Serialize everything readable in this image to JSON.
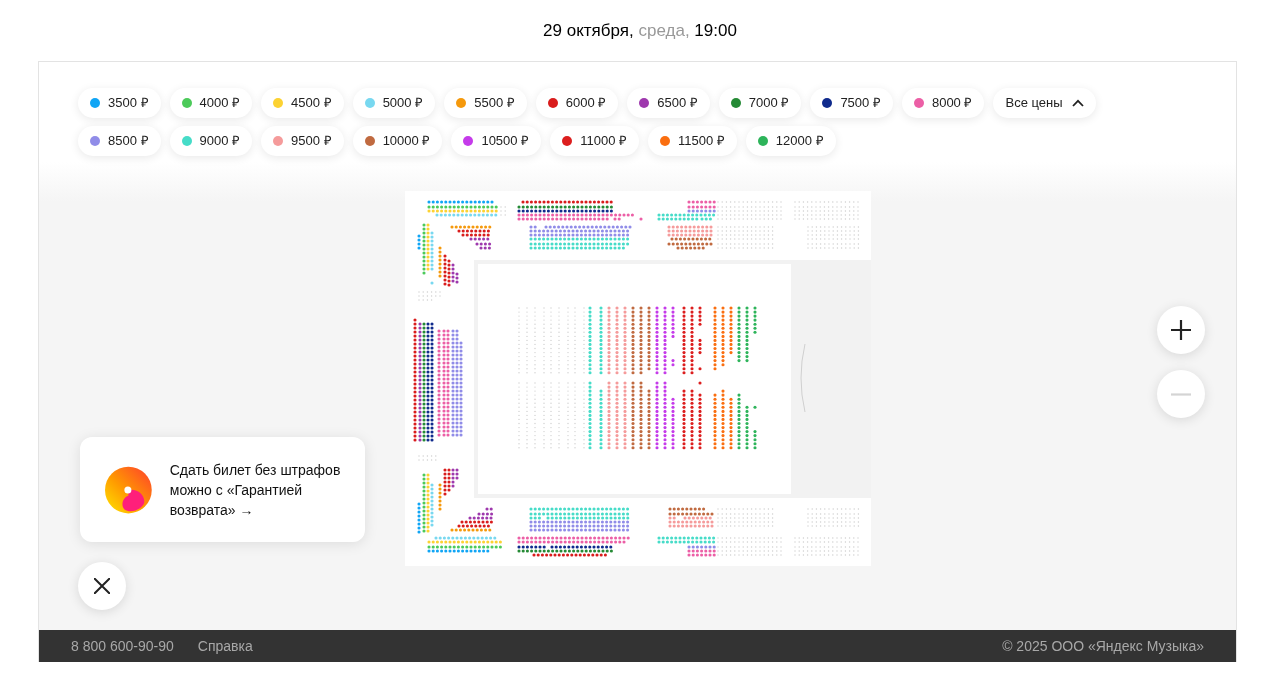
{
  "event_datetime": {
    "date": "29 октября,",
    "weekday": "среда,",
    "time": "19:00"
  },
  "price_filter_rows": [
    {
      "chips": [
        {
          "label": "3500 ₽",
          "color": "#10a5f5"
        },
        {
          "label": "4000 ₽",
          "color": "#4cca5a"
        },
        {
          "label": "4500 ₽",
          "color": "#fcd232"
        },
        {
          "label": "5000 ₽",
          "color": "#78d8f0"
        },
        {
          "label": "5500 ₽",
          "color": "#f5990c"
        },
        {
          "label": "6000 ₽",
          "color": "#d91c1c"
        },
        {
          "label": "6500 ₽",
          "color": "#9e38ad"
        },
        {
          "label": "7000 ₽",
          "color": "#258a35"
        },
        {
          "label": "7500 ₽",
          "color": "#0f2a8c"
        },
        {
          "label": "8000 ₽",
          "color": "#ec5fa6"
        }
      ],
      "toggle": {
        "label": "Все цены",
        "expanded": true
      }
    },
    {
      "chips": [
        {
          "label": "8500 ₽",
          "color": "#908ce8"
        },
        {
          "label": "9000 ₽",
          "color": "#46dcc8"
        },
        {
          "label": "9500 ₽",
          "color": "#f59b9b"
        },
        {
          "label": "10000 ₽",
          "color": "#c06a40"
        },
        {
          "label": "10500 ₽",
          "color": "#c53bea"
        },
        {
          "label": "11000 ₽",
          "color": "#dc1e1e"
        },
        {
          "label": "11500 ₽",
          "color": "#fa6e10"
        },
        {
          "label": "12000 ₽",
          "color": "#2db45a"
        }
      ]
    }
  ],
  "zoom_controls": [
    {
      "kind": "plus",
      "disabled": false
    },
    {
      "kind": "minus",
      "disabled": true
    }
  ],
  "promo": {
    "text": "Сдать билет без штрафов можно с «Гарантией возврата» →"
  },
  "footer": {
    "phone": "8 800 600-90-90",
    "help_link": "Справка",
    "copyright": "© 2025 ООО «Яндекс Музыка»"
  }
}
